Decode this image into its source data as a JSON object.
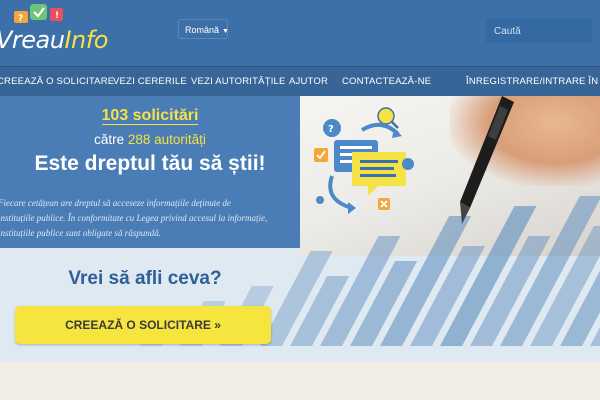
{
  "header": {
    "logo_part1": "Vreau",
    "logo_part2": "Info",
    "language": "Română",
    "search_placeholder": "Caută"
  },
  "nav": {
    "items": [
      "CREEAZĂ O SOLICITARE",
      "VEZI CERERILE",
      "VEZI AUTORITĂȚILE",
      "AJUTOR",
      "CONTACTEAZĂ-NE"
    ],
    "login": "ÎNREGISTRARE/INTRARE ÎN CONT"
  },
  "hero": {
    "requests_count": "103 solicitări",
    "authorities_prefix": "către",
    "authorities_count": "288 autorități",
    "slogan": "Este dreptul tău să știi!",
    "intro_line1": "Fiecare cetățean are dreptul să acceseze informațiile deținute de",
    "intro_line2": "instituțiile publice. În conformitate cu Legea privind accesul la informație,",
    "intro_line3": "instituțiile publice sunt obligate să răspundă.",
    "question": "Vrei să afli ceva?",
    "cta_label": "CREEAZĂ O SOLICITARE »"
  },
  "colors": {
    "header_bg": "#3d6fa8",
    "nav_bg": "#386597",
    "accent_yellow": "#f5e246",
    "stats_bg": "#4a7cb5"
  }
}
